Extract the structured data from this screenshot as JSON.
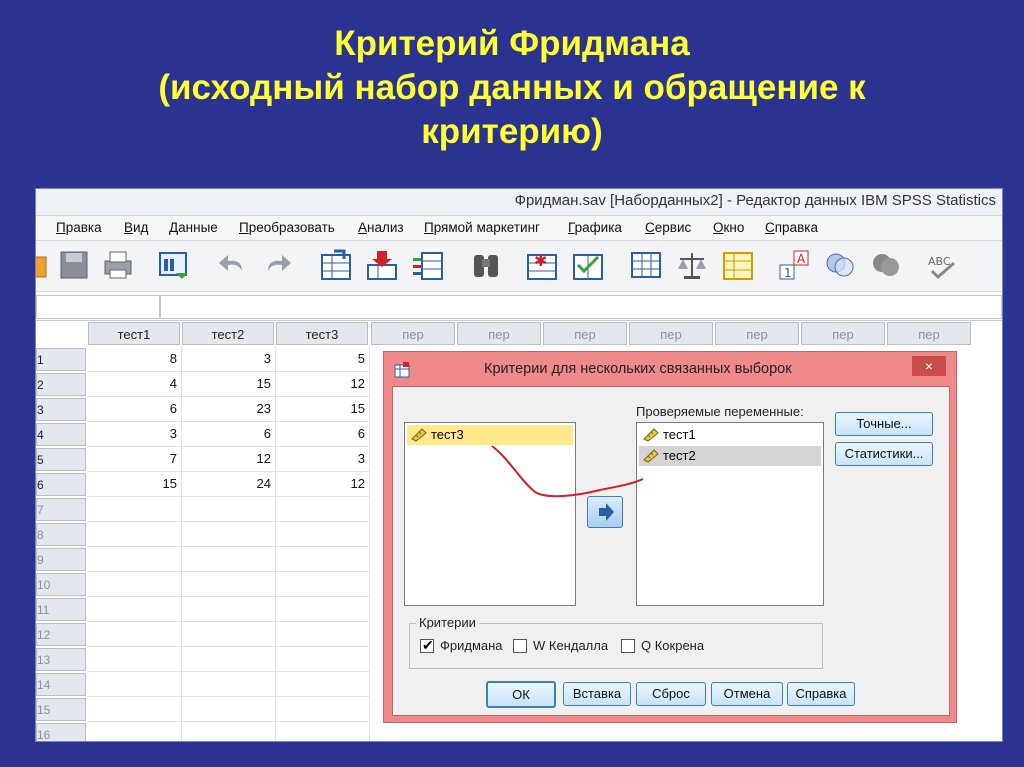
{
  "slide": {
    "title_line1": "Критерий Фридмана",
    "title_line2": "(исходный набор данных и обращение к",
    "title_line3": "критерию)"
  },
  "window": {
    "title": "Фридман.sav [Наборданных2] - Редактор данных IBM SPSS Statistics"
  },
  "menu": [
    "Правка",
    "Вид",
    "Данные",
    "Преобразовать",
    "Анализ",
    "Прямой маркетинг",
    "Графика",
    "Сервис",
    "Окно",
    "Справка"
  ],
  "grid": {
    "columns": [
      "тест1",
      "тест2",
      "тест3",
      "пер",
      "пер",
      "пер",
      "пер",
      "пер",
      "пер",
      "пер"
    ],
    "row_numbers": [
      "1",
      "2",
      "3",
      "4",
      "5",
      "6",
      "7",
      "8",
      "9",
      "10",
      "11",
      "12",
      "13",
      "14",
      "15",
      "16"
    ],
    "rows": [
      [
        "8",
        "3",
        "5"
      ],
      [
        "4",
        "15",
        "12"
      ],
      [
        "6",
        "23",
        "15"
      ],
      [
        "3",
        "6",
        "6"
      ],
      [
        "7",
        "12",
        "3"
      ],
      [
        "15",
        "24",
        "12"
      ]
    ]
  },
  "dialog": {
    "title": "Критерии для нескольких связанных выборок",
    "close_label": "×",
    "source_items": [
      "тест3"
    ],
    "test_vars_label": "Проверяемые переменные:",
    "test_items": [
      "тест1",
      "тест2"
    ],
    "exact_label": "Точные...",
    "stats_label": "Статистики...",
    "criteria_label": "Критерии",
    "checks": [
      {
        "label": "Фридмана",
        "checked": true
      },
      {
        "label": "W Кендалла",
        "checked": false
      },
      {
        "label": "Q Кокрена",
        "checked": false
      }
    ],
    "buttons": {
      "ok": "ОК",
      "paste": "Вставка",
      "reset": "Сброс",
      "cancel": "Отмена",
      "help": "Справка"
    }
  },
  "colors": {
    "background": "#2b3391",
    "title": "#ffff33",
    "dialog_frame": "#f08a8a",
    "annotation": "#d0202a"
  }
}
